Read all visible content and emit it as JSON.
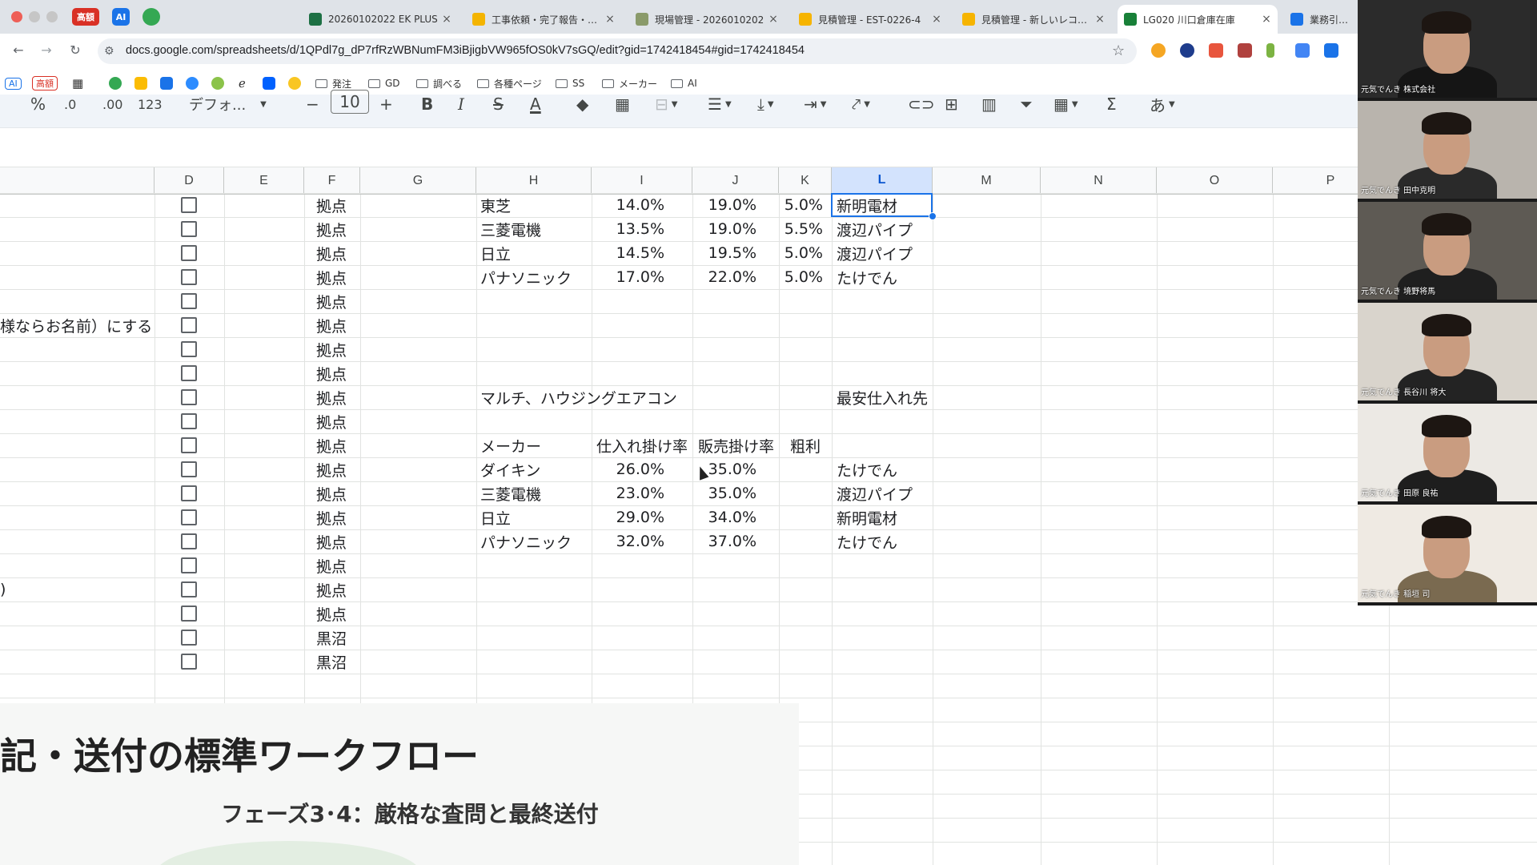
{
  "browser": {
    "pinned": [
      {
        "label": "高額",
        "color": "#d93025"
      },
      {
        "label": "AI",
        "color": "#1a73e8"
      },
      {
        "label": "",
        "color": "#34a853"
      }
    ],
    "tabs": [
      {
        "title": "20260102022 EK PLUS",
        "icon": "excel-icon",
        "color": "#1d7044",
        "active": false
      },
      {
        "title": "工事依頼・完了報告・請求",
        "icon": "forms-icon",
        "color": "#f4b400",
        "active": false
      },
      {
        "title": "現場管理 - 2026010202",
        "icon": "image-icon",
        "color": "#8a9a6a",
        "active": false
      },
      {
        "title": "見積管理 - EST-0226-4",
        "icon": "slides-icon",
        "color": "#f6b400",
        "active": false
      },
      {
        "title": "見積管理 - 新しいレコード",
        "icon": "slides-icon",
        "color": "#f6b400",
        "active": false
      },
      {
        "title": "LG020 川口倉庫在庫",
        "icon": "sheets-icon",
        "color": "#188038",
        "active": true
      },
      {
        "title": "業務引き継ぎ",
        "icon": "g-icon",
        "color": "#1a73e8",
        "active": false
      }
    ],
    "url": "docs.google.com/spreadsheets/d/1QPdl7g_dP7rfRzWBNumFM3iBjigbVW965fOS0kV7sGQ/edit?gid=1742418454#gid=1742418454",
    "bookmarks": [
      {
        "label": "AI",
        "type": "pill"
      },
      {
        "label": "高額",
        "type": "pill-red"
      },
      {
        "label": "",
        "type": "grid"
      },
      {
        "label": "発注",
        "type": "folder"
      },
      {
        "label": "GD",
        "type": "folder"
      },
      {
        "label": "調べる",
        "type": "folder"
      },
      {
        "label": "各種ページ",
        "type": "folder"
      },
      {
        "label": "SS",
        "type": "folder"
      },
      {
        "label": "メーカー",
        "type": "folder"
      },
      {
        "label": "AI",
        "type": "folder"
      }
    ]
  },
  "sheet_toolbar": {
    "percent": "%",
    "dec_dec": ".0",
    "dec_inc": ".00",
    "number_format": "123",
    "font": "デフォ...",
    "minus": "−",
    "font_size": "10",
    "plus": "+",
    "bold": "B",
    "italic": "I",
    "strike": "S",
    "text_color": "A",
    "sigma": "Σ",
    "ime": "あ"
  },
  "columns": [
    "D",
    "E",
    "F",
    "G",
    "H",
    "I",
    "J",
    "K",
    "L",
    "M",
    "N",
    "O",
    "P"
  ],
  "selected_column": "L",
  "active_cell_value": "新明電材",
  "left_fragments": {
    "row6": "様ならお名前）にする",
    "row17": ")"
  },
  "f_column": [
    "拠点",
    "拠点",
    "拠点",
    "拠点",
    "拠点",
    "拠点",
    "拠点",
    "拠点",
    "拠点",
    "拠点",
    "拠点",
    "拠点",
    "拠点",
    "拠点",
    "拠点",
    "拠点",
    "拠点",
    "拠点",
    "黒沼",
    "黒沼"
  ],
  "table1": [
    {
      "maker": "東芝",
      "i": "14.0%",
      "j": "19.0%",
      "k": "5.0%",
      "l": "新明電材"
    },
    {
      "maker": "三菱電機",
      "i": "13.5%",
      "j": "19.0%",
      "k": "5.5%",
      "l": "渡辺パイプ"
    },
    {
      "maker": "日立",
      "i": "14.5%",
      "j": "19.5%",
      "k": "5.0%",
      "l": "渡辺パイプ"
    },
    {
      "maker": "パナソニック",
      "i": "17.0%",
      "j": "22.0%",
      "k": "5.0%",
      "l": "たけでん"
    }
  ],
  "section2": {
    "title": "マルチ、ハウジングエアコン",
    "cheapest_label": "最安仕入れ先",
    "headers": {
      "maker": "メーカー",
      "cost": "仕入れ掛け率",
      "sale": "販売掛け率",
      "margin": "粗利"
    },
    "rows": [
      {
        "maker": "ダイキン",
        "i": "26.0%",
        "j": "35.0%",
        "l": "たけでん"
      },
      {
        "maker": "三菱電機",
        "i": "23.0%",
        "j": "35.0%",
        "l": "渡辺パイプ"
      },
      {
        "maker": "日立",
        "i": "29.0%",
        "j": "34.0%",
        "l": "新明電材"
      },
      {
        "maker": "パナソニック",
        "i": "32.0%",
        "j": "37.0%",
        "l": "たけでん"
      }
    ]
  },
  "slide": {
    "title": "記・送付の標準ワークフロー",
    "subtitle": "フェーズ3･4：厳格な査問と最終送付"
  },
  "participants": [
    {
      "name": "元気でんき 株式会社",
      "bg": "#2b2b2b",
      "shirt": "#151515"
    },
    {
      "name": "元気でんき 田中克明",
      "bg": "#b9b4ad",
      "shirt": "#2a2a2a"
    },
    {
      "name": "元気でんき 境野将馬",
      "bg": "#5e5a54",
      "shirt": "#1f1f1f"
    },
    {
      "name": "元気でんき 長谷川 将大",
      "bg": "#d9d4cc",
      "shirt": "#232323"
    },
    {
      "name": "元気でんき 田原 良祐",
      "bg": "#ece9e4",
      "shirt": "#1e1e1e"
    },
    {
      "name": "元気でんき 稲垣 司",
      "bg": "#efeae3",
      "shirt": "#7a6a50"
    }
  ]
}
